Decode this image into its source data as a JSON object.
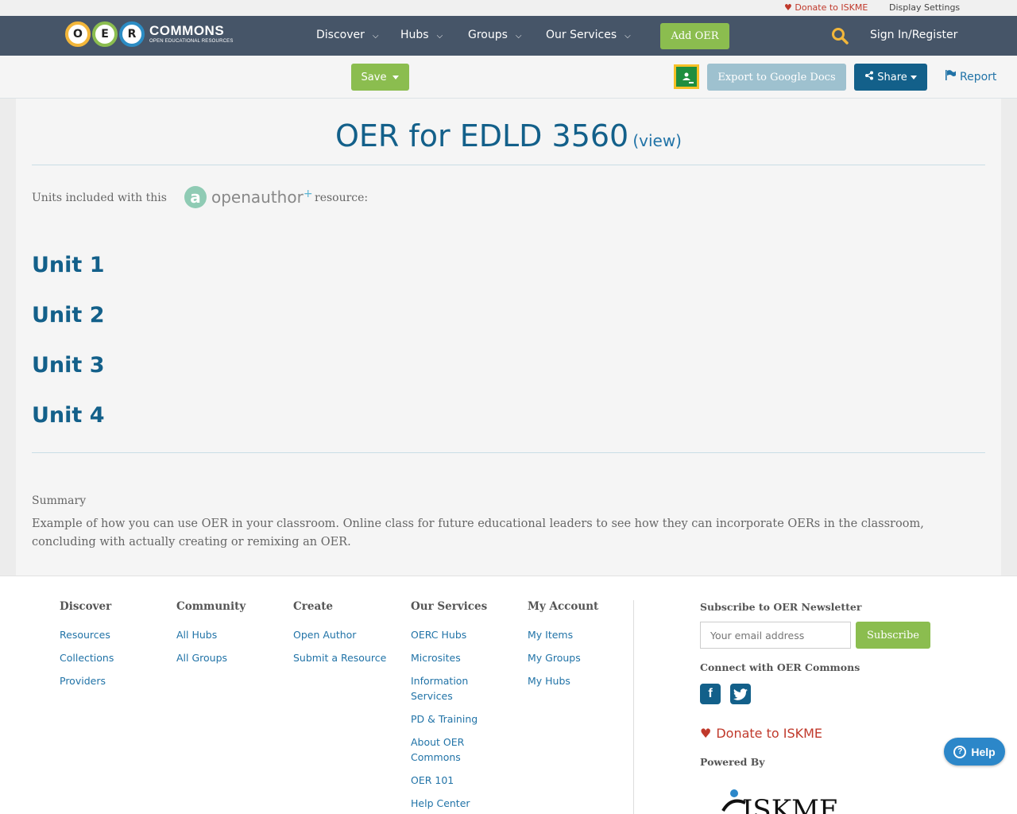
{
  "utility": {
    "donate": "Donate to ISKME",
    "display_settings": "Display Settings"
  },
  "logo": {
    "big": "COMMONS",
    "small": "OPEN EDUCATIONAL RESOURCES",
    "letters": [
      "O",
      "E",
      "R"
    ]
  },
  "nav": {
    "items": [
      {
        "label": "Discover"
      },
      {
        "label": "Hubs"
      },
      {
        "label": "Groups"
      },
      {
        "label": "Our Services"
      }
    ],
    "add_oer": "Add OER",
    "sign_in": "Sign In/Register"
  },
  "actions": {
    "save": "Save",
    "export": "Export to Google Docs",
    "share": "Share",
    "report": "Report"
  },
  "resource": {
    "title": "OER for EDLD 3560",
    "view": "(view)",
    "units_label": "Units included with this",
    "openauthor": "openauthor",
    "resource_label": "resource:",
    "units": [
      "Unit 1",
      "Unit 2",
      "Unit 3",
      "Unit 4"
    ],
    "summary_heading": "Summary",
    "summary": "Example of how you can use OER in your classroom. Online class for future educational leaders to see how they can incorporate OERs in the classroom, concluding with actually creating or remixing an OER."
  },
  "footer": {
    "columns": [
      {
        "heading": "Discover",
        "links": [
          "Resources",
          "Collections",
          "Providers"
        ]
      },
      {
        "heading": "Community",
        "links": [
          "All Hubs",
          "All Groups"
        ]
      },
      {
        "heading": "Create",
        "links": [
          "Open Author",
          "Submit a Resource"
        ]
      },
      {
        "heading": "Our Services",
        "links": [
          "OERC Hubs",
          "Microsites",
          "Information Services",
          "PD & Training",
          "About OER Commons",
          "OER 101",
          "Help Center"
        ]
      },
      {
        "heading": "My Account",
        "links": [
          "My Items",
          "My Groups",
          "My Hubs"
        ]
      }
    ],
    "newsletter_heading": "Subscribe to OER Newsletter",
    "email_placeholder": "Your email address",
    "subscribe": "Subscribe",
    "connect_heading": "Connect with OER Commons",
    "donate": "Donate to ISKME",
    "powered_by": "Powered By",
    "iskme": "ISKME"
  },
  "help": "Help",
  "colors": {
    "nav_bg": "#465568",
    "green": "#8bbd4f",
    "blue": "#13608a",
    "link": "#2173a7",
    "donate_red": "#c0392b"
  }
}
